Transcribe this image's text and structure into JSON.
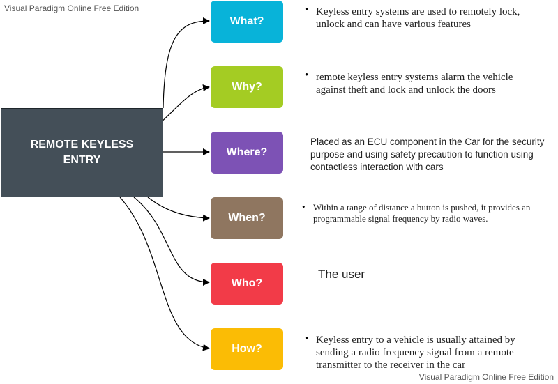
{
  "watermark": {
    "top": "Visual Paradigm Online Free Edition",
    "bottom": "Visual Paradigm Online Free Edition"
  },
  "central": {
    "label": "REMOTE KEYLESS ENTRY",
    "color": "#444f58"
  },
  "questions": [
    {
      "label": "What?",
      "color": "#08b3d9",
      "description": "Keyless entry systems are used to remotely lock, unlock and can have various features"
    },
    {
      "label": "Why?",
      "color": "#a4cc23",
      "description": "remote keyless entry systems alarm the vehicle against theft and lock and unlock the doors"
    },
    {
      "label": "Where?",
      "color": "#7d52b5",
      "description": "Placed as an ECU component in the Car for the security purpose and using safety precaution to function using contactless interaction with cars"
    },
    {
      "label": "When?",
      "color": "#8f7660",
      "description": "Within a range of distance a button is pushed, it provides an programmable signal frequency by radio waves."
    },
    {
      "label": "Who?",
      "color": "#f23b48",
      "description": "The user"
    },
    {
      "label": "How?",
      "color": "#fbbc05",
      "description": "Keyless entry to a vehicle is usually attained by sending a radio frequency signal from a remote transmitter to the receiver in the car"
    }
  ]
}
